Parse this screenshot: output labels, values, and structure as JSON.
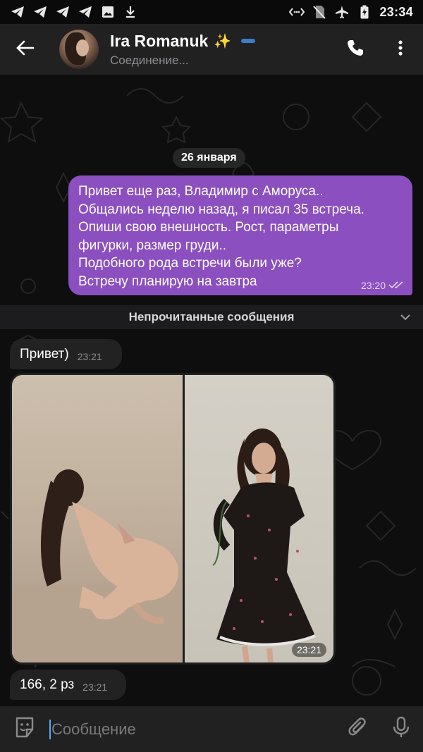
{
  "status_bar": {
    "time": "23:34",
    "left_icons": [
      "telegram-icon",
      "telegram-icon",
      "telegram-icon",
      "telegram-icon",
      "image-icon",
      "download-icon"
    ],
    "right_icons": [
      "data-saver-icon",
      "no-sim-icon",
      "airplane-icon",
      "battery-icon"
    ]
  },
  "header": {
    "name": "Ira Romanuk",
    "emoji": "✨",
    "status": "Соединение...",
    "colors": {
      "premium_badge": "#3b7ec9"
    }
  },
  "chat": {
    "date": "26 января",
    "outgoing": {
      "lines": [
        "Привет еще раз, Владимир с Аморуса..",
        "Общались неделю назад, я писал 35 встреча.",
        "Опиши свою внешность. Рост, параметры",
        "фигурки, размер груди..",
        "Подобного рода встречи были уже?",
        "Встречу планирую на завтра"
      ],
      "time": "23:20",
      "read": true,
      "color": "#8b4fc0"
    },
    "unread_label": "Непрочитанные сообщения",
    "incoming": [
      {
        "text": "Привет)",
        "time": "23:21"
      },
      {
        "text": "166, 2 рз",
        "time": "23:21"
      }
    ],
    "album": {
      "time": "23:21"
    }
  },
  "input": {
    "placeholder": "Сообщение"
  }
}
